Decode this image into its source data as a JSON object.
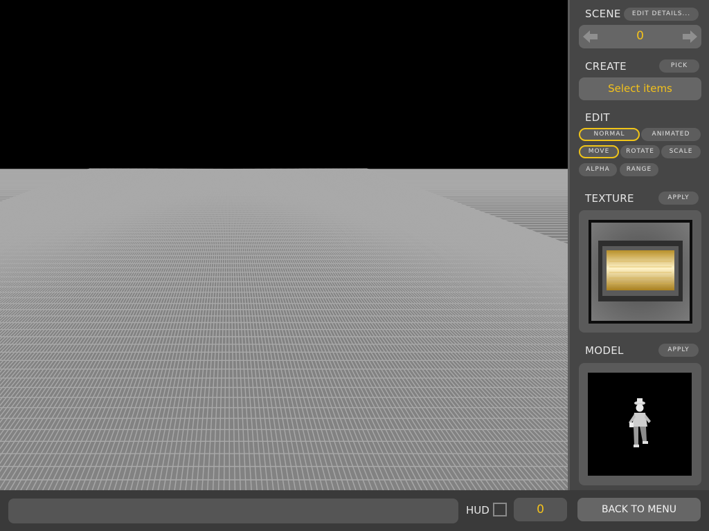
{
  "panel": {
    "scene": {
      "title": "SCENE",
      "edit_details_label": "EDIT DETAILS...",
      "value": "0",
      "prev_icon": "left-arrow-icon",
      "next_icon": "right-arrow-icon"
    },
    "create": {
      "title": "CREATE",
      "pick_label": "PICK",
      "select_label": "Select items"
    },
    "edit": {
      "title": "EDIT",
      "mode_buttons": [
        {
          "label": "NORMAL",
          "active": true
        },
        {
          "label": "ANIMATED",
          "active": false
        }
      ],
      "transform_buttons": [
        {
          "label": "MOVE",
          "active": true
        },
        {
          "label": "ROTATE",
          "active": false
        },
        {
          "label": "SCALE",
          "active": false
        },
        {
          "label": "ALPHA",
          "active": false
        },
        {
          "label": "RANGE",
          "active": false
        }
      ]
    },
    "texture": {
      "title": "TEXTURE",
      "apply_label": "APPLY"
    },
    "model": {
      "title": "MODEL",
      "apply_label": "APPLY"
    }
  },
  "bottom": {
    "command_value": "",
    "hud_label": "HUD",
    "hud_checked": false,
    "hud_value": "0",
    "back_label": "BACK TO MENU"
  },
  "colors": {
    "accent": "#f4c21b",
    "panel_bg": "#464646",
    "button_bg": "#5d5d5d",
    "floor": "#828282",
    "sky": "#000000"
  }
}
